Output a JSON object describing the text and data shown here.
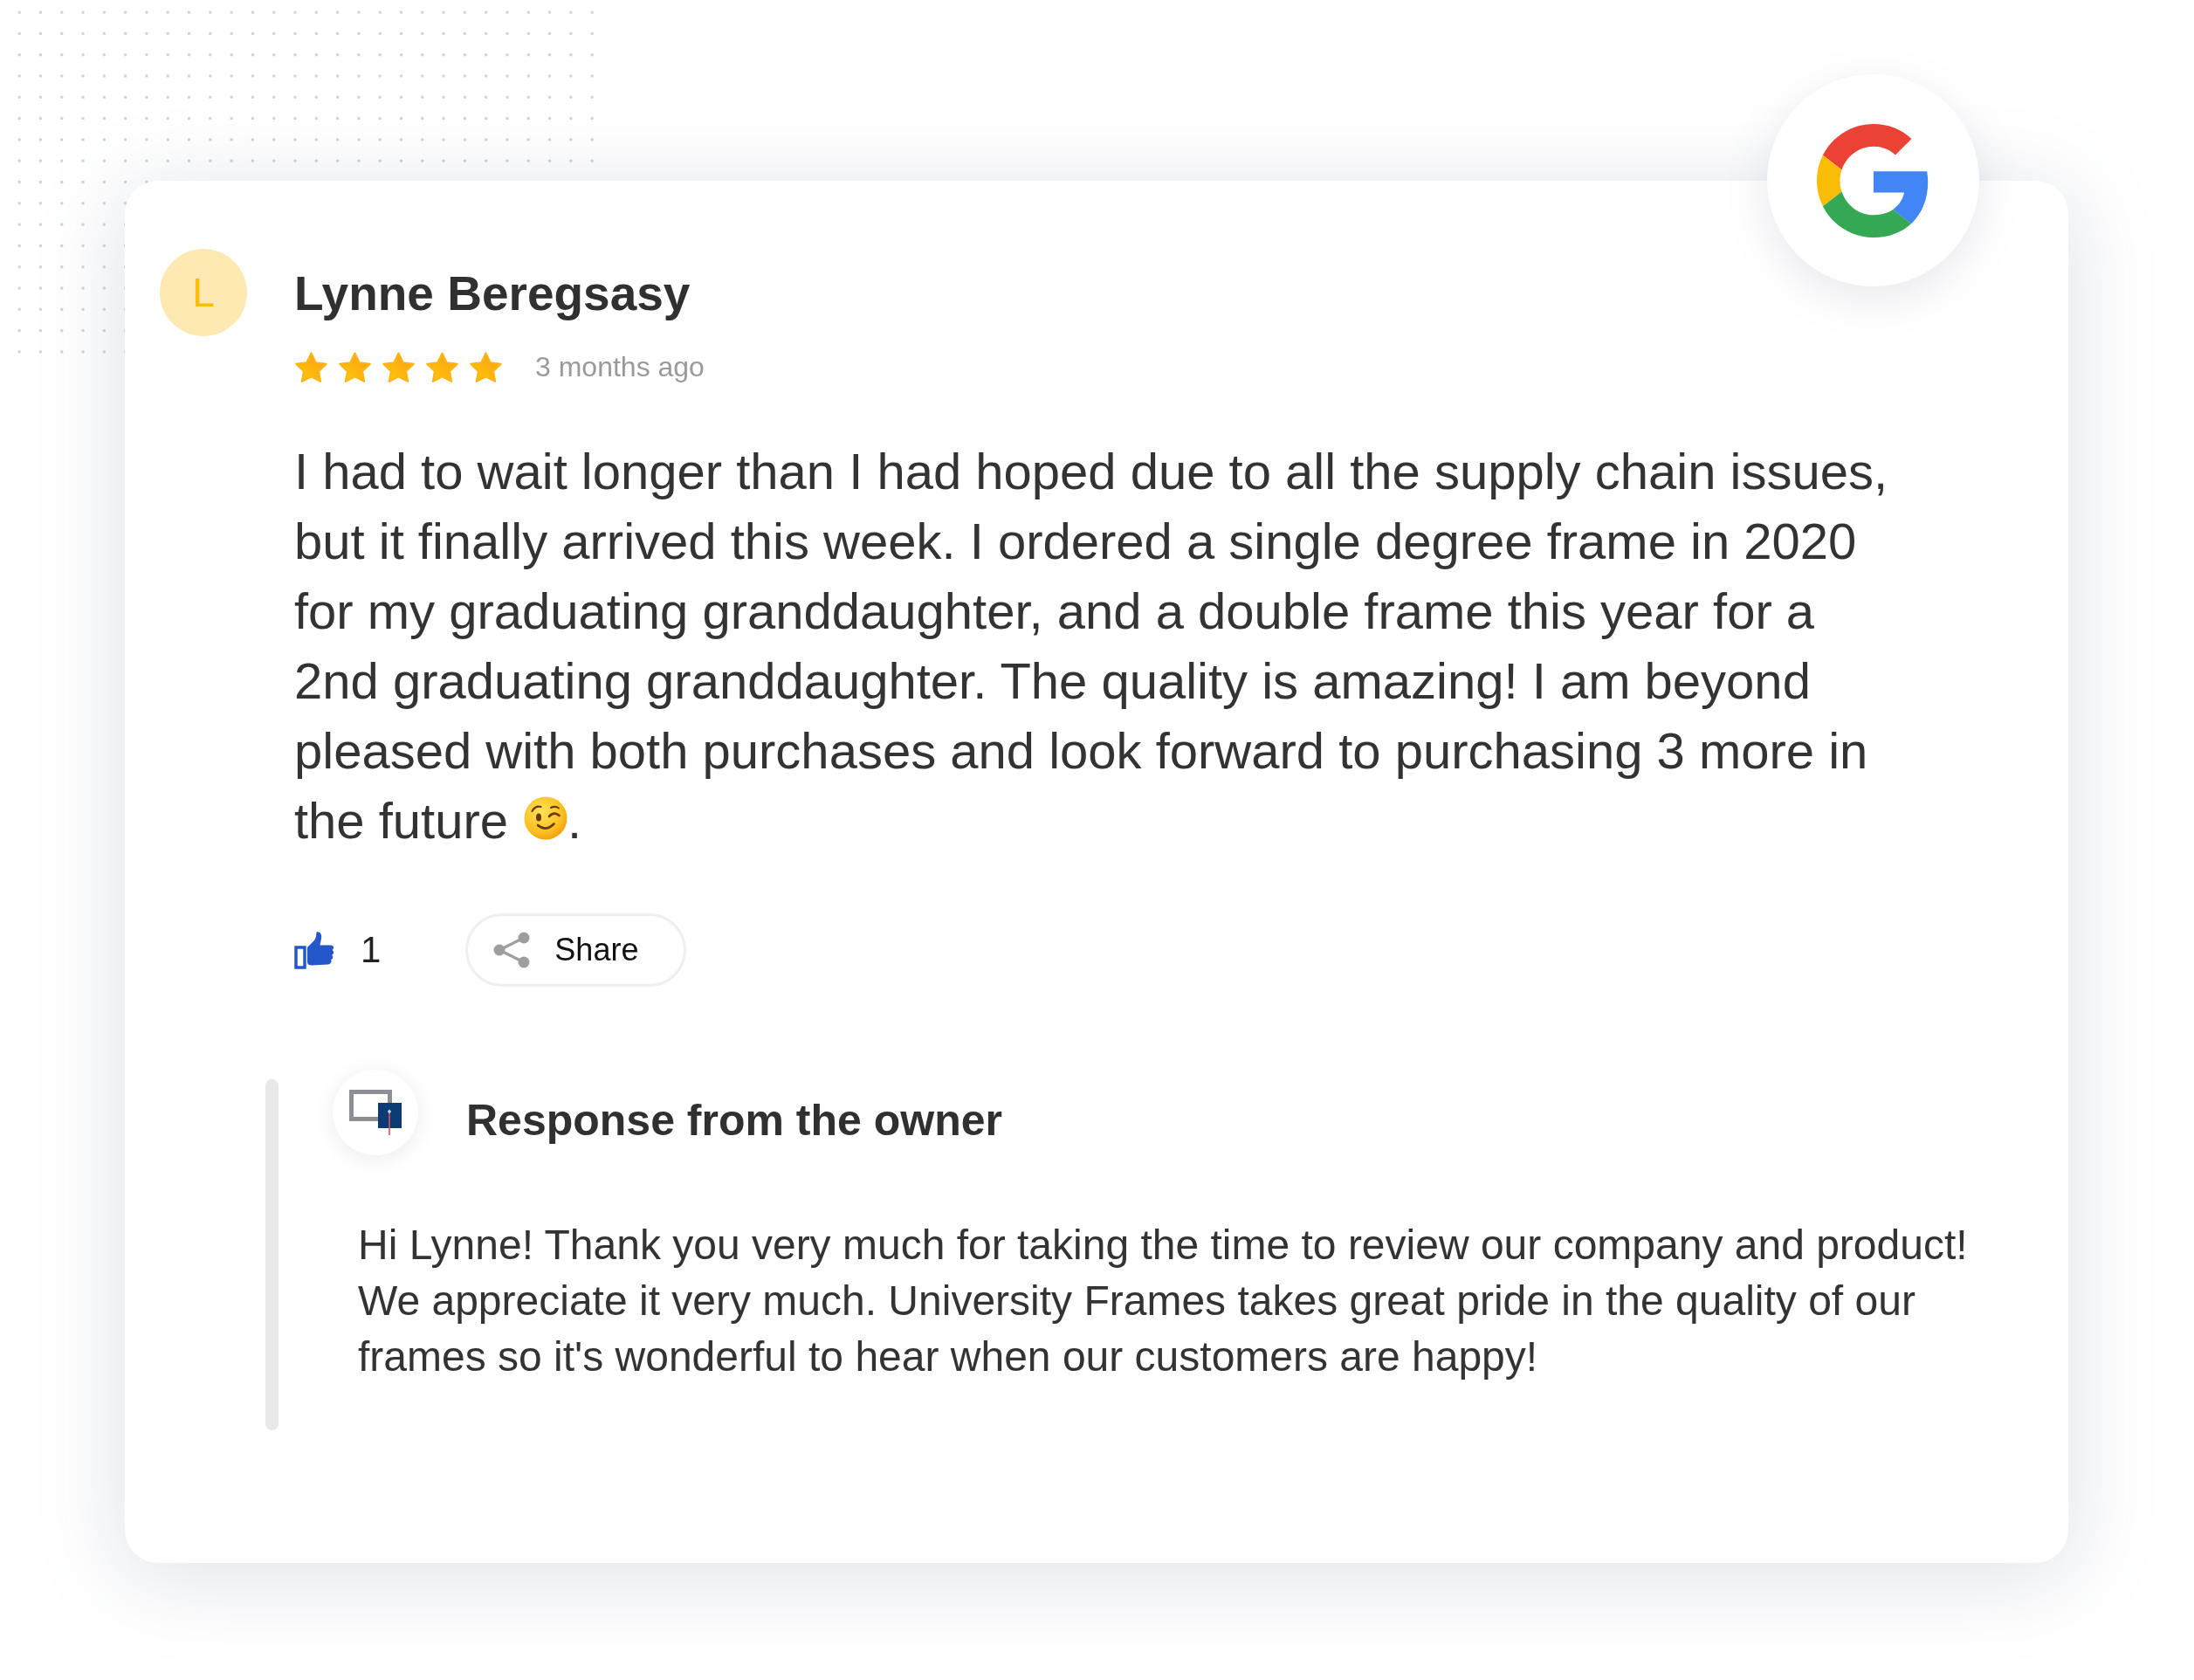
{
  "review": {
    "avatar_initial": "L",
    "name": "Lynne Beregsasy",
    "stars": 5,
    "time": "3 months ago",
    "text": "I had to wait longer than I had hoped due to all the supply chain issues, but it finally arrived this week. I ordered a single degree frame in 2020 for my graduating granddaughter, and a double frame this year for a 2nd graduating granddaughter. The quality is amazing! I am beyond pleased with both purchases and look forward to purchasing 3 more in",
    "text_before_emoji": "the future",
    "text_after_emoji": ".",
    "like_count": "1",
    "share_label": "Share"
  },
  "owner_response": {
    "title": "Response from the owner",
    "text": "Hi Lynne! Thank you very much for taking the time to review our company and product! We appreciate it very much. University Frames takes great pride in the quality of our frames so it's wonderful to hear when our customers are happy!"
  }
}
